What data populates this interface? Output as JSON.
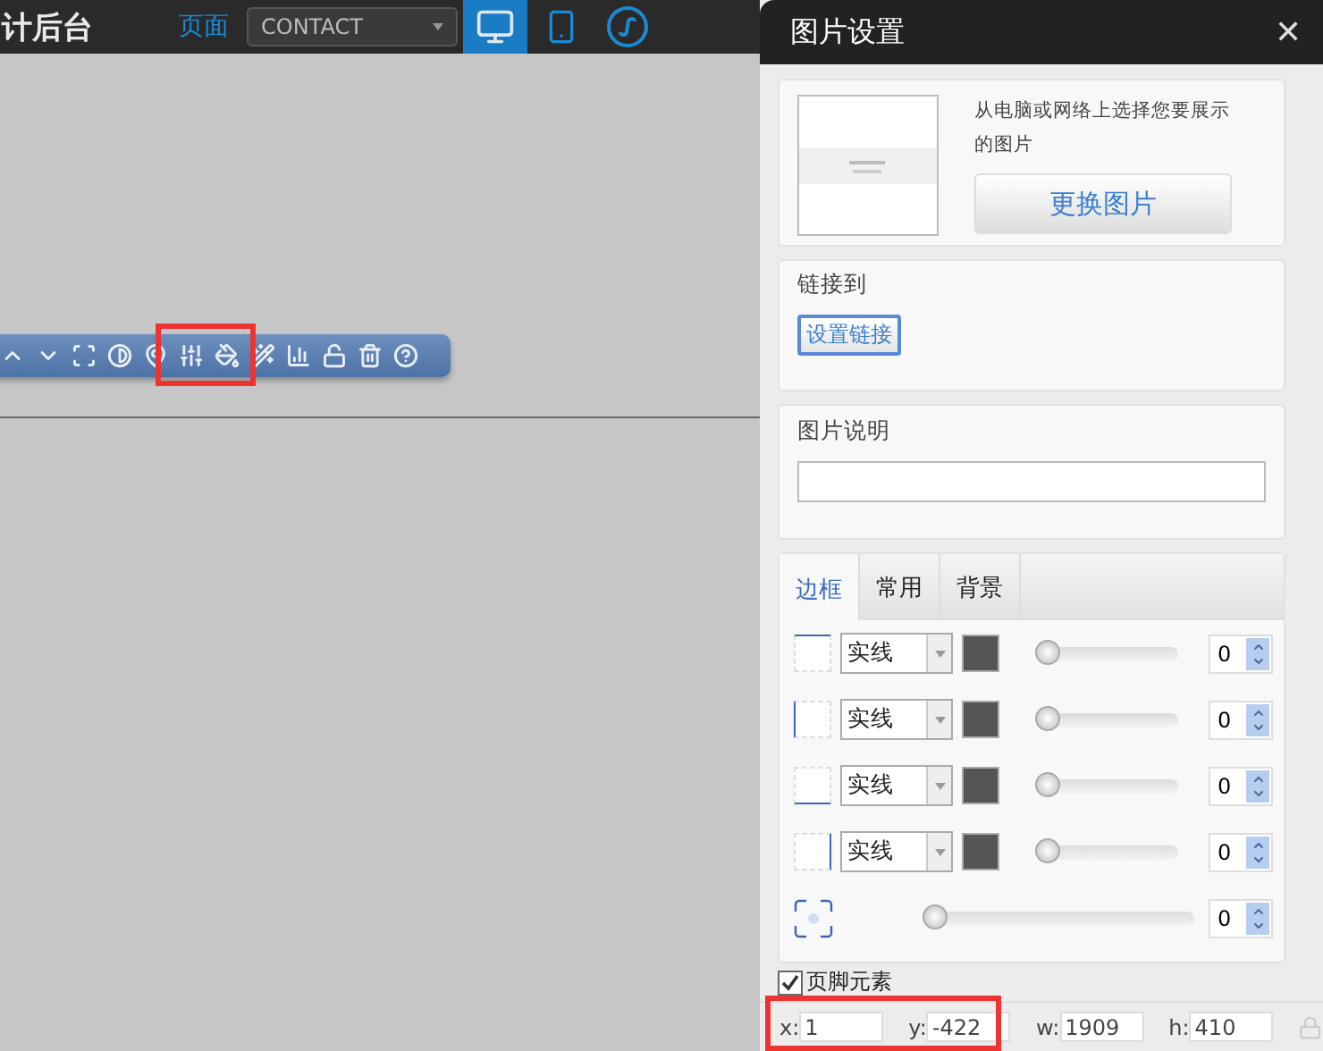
{
  "topbar": {
    "title": "计后台",
    "page_label": "页面",
    "page_select": "CONTACT",
    "devices": [
      {
        "kind": "desktop",
        "selected": true
      },
      {
        "kind": "mobile",
        "selected": false
      },
      {
        "kind": "miniapp",
        "selected": false
      }
    ]
  },
  "panel": {
    "title": "图片设置",
    "close": "✕",
    "image": {
      "hint": "从电脑或网络上选择您要展示的图片",
      "button": "更换图片"
    },
    "link": {
      "label": "链接到",
      "button": "设置链接"
    },
    "caption": {
      "label": "图片说明"
    },
    "tabs": [
      {
        "label": "边框",
        "selected": true
      },
      {
        "label": "常用",
        "selected": false
      },
      {
        "label": "背景",
        "selected": false
      }
    ],
    "border_rows": [
      {
        "kind": "top",
        "style": "实线",
        "color": "#555555",
        "level": 0,
        "value": "0"
      },
      {
        "kind": "left",
        "style": "实线",
        "color": "#555555",
        "level": 0,
        "value": "0"
      },
      {
        "kind": "bottom",
        "style": "实线",
        "color": "#555555",
        "level": 0,
        "value": "0"
      },
      {
        "kind": "right",
        "style": "实线",
        "color": "#555555",
        "level": 0,
        "value": "0"
      },
      {
        "kind": "radius",
        "level": 0,
        "value": "0"
      }
    ],
    "footer_element": {
      "label": "页脚元素",
      "checked": true
    },
    "position": [
      {
        "label": "x:",
        "value": "1"
      },
      {
        "label": "y:",
        "value": "-422"
      },
      {
        "label": "w:",
        "value": "1909"
      },
      {
        "label": "h:",
        "value": "410"
      }
    ]
  }
}
